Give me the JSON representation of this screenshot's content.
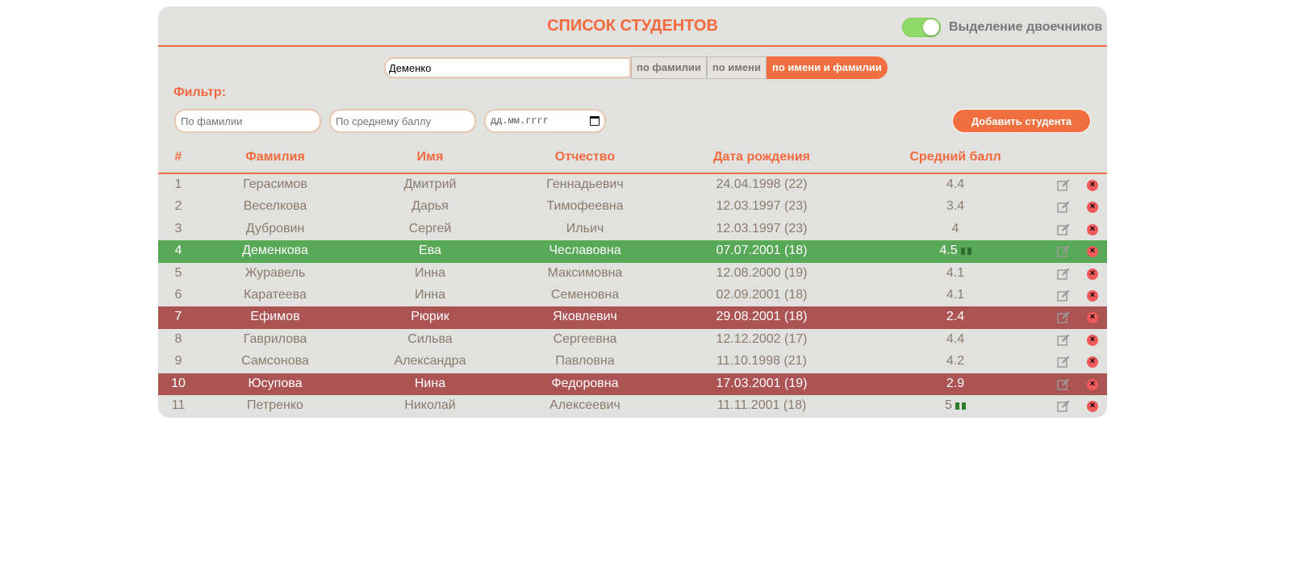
{
  "header": {
    "title": "СПИСОК СТУДЕНТОВ",
    "toggle_label": "Выделение двоечников"
  },
  "search": {
    "value": "Деменко",
    "options": [
      "по фамилии",
      "по имени",
      "по имени и фамилии"
    ],
    "active": "по имени и фамилии"
  },
  "filter": {
    "label": "Фильтр:",
    "lastname_placeholder": "По фамилии",
    "avg_placeholder": "По среднему баллу",
    "date_placeholder": "дд.мм.гггг"
  },
  "add_button": "Добавить студента",
  "columns": [
    "#",
    "Фамилия",
    "Имя",
    "Отчество",
    "Дата рождения",
    "Средний балл"
  ],
  "colors": {
    "accent": "#f2703f",
    "highlight": "#57a857",
    "failing": "#ac5354",
    "panel": "#e1e2df"
  },
  "students": [
    {
      "num": "1",
      "last": "Герасимов",
      "first": "Дмитрий",
      "middle": "Геннадьевич",
      "birth": "24.04.1998 (22)",
      "avg": "4.4",
      "gift": false,
      "state": "normal"
    },
    {
      "num": "2",
      "last": "Веселкова",
      "first": "Дарья",
      "middle": "Тимофеевна",
      "birth": "12.03.1997 (23)",
      "avg": "3.4",
      "gift": false,
      "state": "normal"
    },
    {
      "num": "3",
      "last": "Дубровин",
      "first": "Сергей",
      "middle": "Ильич",
      "birth": "12.03.1997 (23)",
      "avg": "4",
      "gift": false,
      "state": "normal"
    },
    {
      "num": "4",
      "last": "Деменкова",
      "first": "Ева",
      "middle": "Чеславовна",
      "birth": "07.07.2001 (18)",
      "avg": "4.5",
      "gift": true,
      "state": "match"
    },
    {
      "num": "5",
      "last": "Журавель",
      "first": "Инна",
      "middle": "Максимовна",
      "birth": "12.08.2000 (19)",
      "avg": "4.1",
      "gift": false,
      "state": "normal"
    },
    {
      "num": "6",
      "last": "Каратеева",
      "first": "Инна",
      "middle": "Семеновна",
      "birth": "02.09.2001 (18)",
      "avg": "4.1",
      "gift": false,
      "state": "normal"
    },
    {
      "num": "7",
      "last": "Ефимов",
      "first": "Рюрик",
      "middle": "Яковлевич",
      "birth": "29.08.2001 (18)",
      "avg": "2.4",
      "gift": false,
      "state": "failing"
    },
    {
      "num": "8",
      "last": "Гаврилова",
      "first": "Сильва",
      "middle": "Сергеевна",
      "birth": "12.12.2002 (17)",
      "avg": "4.4",
      "gift": false,
      "state": "normal"
    },
    {
      "num": "9",
      "last": "Самсонова",
      "first": "Александра",
      "middle": "Павловна",
      "birth": "11.10.1998 (21)",
      "avg": "4.2",
      "gift": false,
      "state": "normal"
    },
    {
      "num": "10",
      "last": "Юсупова",
      "first": "Нина",
      "middle": "Федоровна",
      "birth": "17.03.2001 (19)",
      "avg": "2.9",
      "gift": false,
      "state": "failing"
    },
    {
      "num": "11",
      "last": "Петренко",
      "first": "Николай",
      "middle": "Алексеевич",
      "birth": "11.11.2001 (18)",
      "avg": "5",
      "gift": true,
      "state": "normal"
    }
  ]
}
